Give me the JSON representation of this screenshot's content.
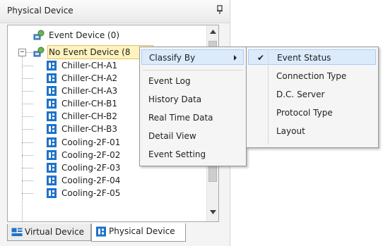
{
  "panel": {
    "title": "Physical Device",
    "pin_icon": "pin-icon"
  },
  "tree": {
    "root_items": [
      {
        "label": "Event Device (0)",
        "icon": "device-group-icon"
      },
      {
        "label": "No Event Device (8",
        "icon": "device-group-icon"
      }
    ],
    "expander_glyph": "−",
    "children": [
      {
        "label": "Chiller-CH-A1",
        "icon": "device-icon"
      },
      {
        "label": "Chiller-CH-A2",
        "icon": "device-icon"
      },
      {
        "label": "Chiller-CH-A3",
        "icon": "device-icon"
      },
      {
        "label": "Chiller-CH-B1",
        "icon": "device-icon"
      },
      {
        "label": "Chiller-CH-B2",
        "icon": "device-icon"
      },
      {
        "label": "Chiller-CH-B3",
        "icon": "device-icon"
      },
      {
        "label": "Cooling-2F-01",
        "icon": "device-icon"
      },
      {
        "label": "Cooling-2F-02",
        "icon": "device-icon"
      },
      {
        "label": "Cooling-2F-03",
        "icon": "device-icon"
      },
      {
        "label": "Cooling-2F-04",
        "icon": "device-icon"
      },
      {
        "label": "Cooling-2F-05",
        "icon": "device-icon"
      }
    ]
  },
  "tabs": [
    {
      "label": "Virtual Device",
      "icon": "virtual-device-icon"
    },
    {
      "label": "Physical Device",
      "icon": "physical-device-icon"
    }
  ],
  "context_menu": {
    "items": [
      "Classify By",
      "Event Log",
      "History Data",
      "Real Time Data",
      "Detail View",
      "Event Setting"
    ]
  },
  "submenu": {
    "items": [
      "Event Status",
      "Connection Type",
      "D.C. Server",
      "Protocol Type",
      "Layout"
    ],
    "checked": "Event Status",
    "check_glyph": "✔"
  },
  "colors": {
    "highlight": "#dcebfc",
    "selection": "#fff3bd",
    "device_icon": "#1e73c8"
  }
}
